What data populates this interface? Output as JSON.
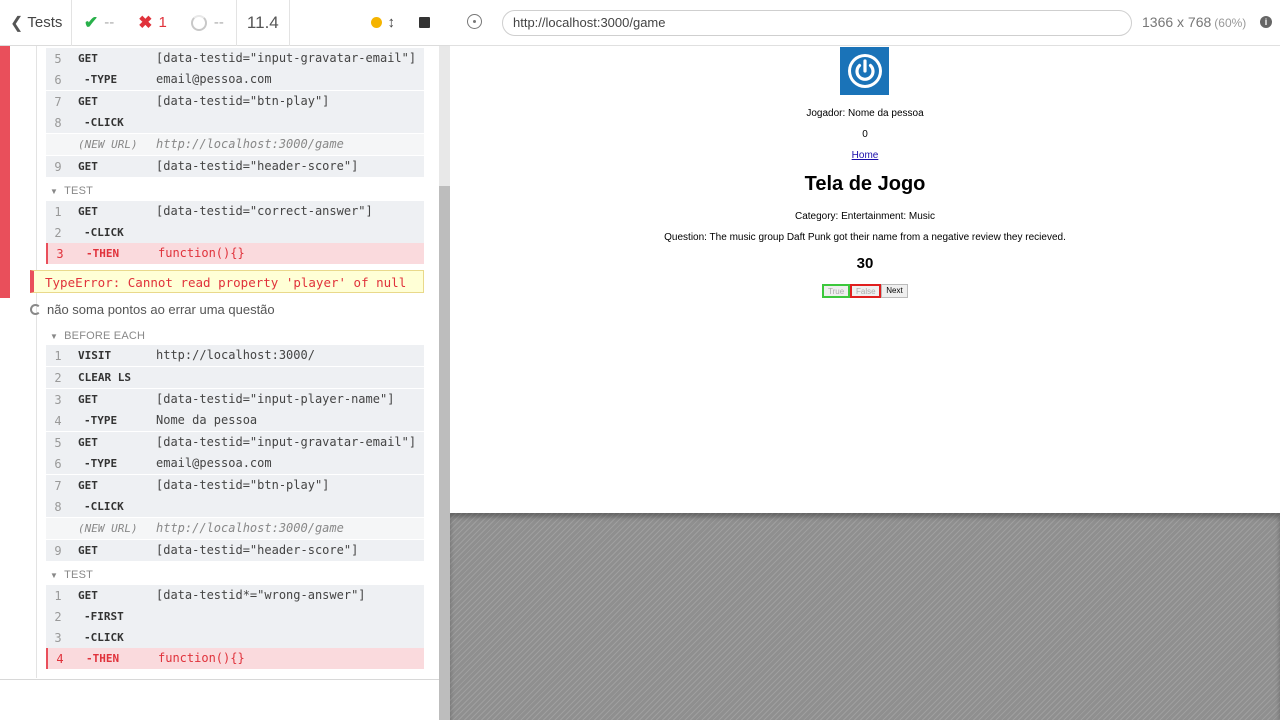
{
  "header": {
    "tests_label": "Tests",
    "passed": "--",
    "failed": "1",
    "pending": "--",
    "duration": "11.4"
  },
  "commands_top": [
    {
      "num": "5",
      "name": "GET",
      "arg": "[data-testid=\"input-gravatar-email\"]"
    },
    {
      "num": "6",
      "name": "-TYPE",
      "arg": "email@pessoa.com"
    },
    {
      "num": "7",
      "name": "GET",
      "arg": "[data-testid=\"btn-play\"]"
    },
    {
      "num": "8",
      "name": "-CLICK",
      "arg": ""
    },
    {
      "num": "",
      "name": "(NEW URL)",
      "arg": "http://localhost:3000/game"
    },
    {
      "num": "9",
      "name": "GET",
      "arg": "[data-testid=\"header-score\"]"
    }
  ],
  "test1": {
    "section": "TEST",
    "commands": [
      {
        "num": "1",
        "name": "GET",
        "arg": "[data-testid=\"correct-answer\"]"
      },
      {
        "num": "2",
        "name": "-CLICK",
        "arg": ""
      },
      {
        "num": "3",
        "name": "-THEN",
        "arg": "function(){}"
      }
    ],
    "error": "TypeError: Cannot read property 'player' of null"
  },
  "test2": {
    "title": "não soma pontos ao errar uma questão",
    "before_each_label": "BEFORE EACH",
    "before_each": [
      {
        "num": "1",
        "name": "VISIT",
        "arg": "http://localhost:3000/"
      },
      {
        "num": "2",
        "name": "CLEAR LS",
        "arg": ""
      },
      {
        "num": "3",
        "name": "GET",
        "arg": "[data-testid=\"input-player-name\"]"
      },
      {
        "num": "4",
        "name": "-TYPE",
        "arg": "Nome da pessoa"
      },
      {
        "num": "5",
        "name": "GET",
        "arg": "[data-testid=\"input-gravatar-email\"]"
      },
      {
        "num": "6",
        "name": "-TYPE",
        "arg": "email@pessoa.com"
      },
      {
        "num": "7",
        "name": "GET",
        "arg": "[data-testid=\"btn-play\"]"
      },
      {
        "num": "8",
        "name": "-CLICK",
        "arg": ""
      },
      {
        "num": "",
        "name": "(NEW URL)",
        "arg": "http://localhost:3000/game"
      },
      {
        "num": "9",
        "name": "GET",
        "arg": "[data-testid=\"header-score\"]"
      }
    ],
    "test_label": "TEST",
    "commands": [
      {
        "num": "1",
        "name": "GET",
        "arg": "[data-testid*=\"wrong-answer\"]"
      },
      {
        "num": "2",
        "name": "-FIRST",
        "arg": ""
      },
      {
        "num": "3",
        "name": "-CLICK",
        "arg": ""
      },
      {
        "num": "4",
        "name": "-THEN",
        "arg": "function(){}"
      }
    ]
  },
  "preview": {
    "url": "http://localhost:3000/game",
    "viewport": "1366 x 768",
    "scale": "(60%)"
  },
  "game": {
    "player": "Jogador: Nome da pessoa",
    "score": "0",
    "home_link": "Home",
    "title": "Tela de Jogo",
    "category": "Category: Entertainment: Music",
    "question": "Question: The music group Daft Punk got their name from a negative review they recieved.",
    "timer": "30",
    "answers": {
      "true": "True",
      "false": "False",
      "next": "Next"
    }
  },
  "colors": {
    "fail": "#e94f5b",
    "pass": "#28b04a",
    "avatar": "#1a73b8"
  }
}
